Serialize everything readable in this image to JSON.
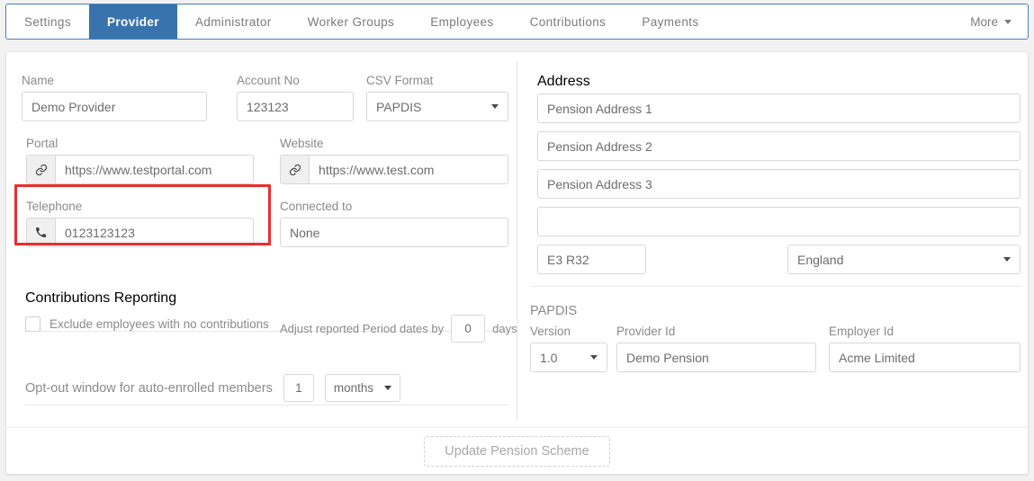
{
  "tabs": [
    {
      "label": "Settings",
      "active": false
    },
    {
      "label": "Provider",
      "active": true
    },
    {
      "label": "Administrator",
      "active": false
    },
    {
      "label": "Worker Groups",
      "active": false
    },
    {
      "label": "Employees",
      "active": false
    },
    {
      "label": "Contributions",
      "active": false
    },
    {
      "label": "Payments",
      "active": false
    }
  ],
  "tabbar": {
    "more_label": "More",
    "active_color": "#3973ad",
    "border_color": "#4a7ebb"
  },
  "form": {
    "name": {
      "label": "Name",
      "value": "Demo Provider"
    },
    "account_no": {
      "label": "Account No",
      "value": "123123"
    },
    "csv_format": {
      "label": "CSV Format",
      "value": "PAPDIS"
    },
    "portal": {
      "label": "Portal",
      "value": "https://www.testportal.com",
      "icon": "link-icon"
    },
    "website": {
      "label": "Website",
      "value": "https://www.test.com",
      "icon": "link-icon"
    },
    "telephone": {
      "label": "Telephone",
      "value": "0123123123",
      "icon": "phone-icon"
    },
    "connected_to": {
      "label": "Connected to",
      "value": "None"
    }
  },
  "contributions_reporting": {
    "title": "Contributions Reporting",
    "exclude_label": "Exclude employees with no contributions",
    "exclude_checked": false,
    "adjust_prefix": "Adjust reported Period dates by",
    "adjust_value": "0",
    "adjust_suffix": "days"
  },
  "optout": {
    "label": "Opt-out window for auto-enrolled members",
    "value": "1",
    "unit": "months"
  },
  "address": {
    "label": "Address",
    "line1": "Pension Address 1",
    "line2": "Pension Address 2",
    "line3": "Pension Address 3",
    "line4": "",
    "postcode": "E3 R32",
    "country": "England"
  },
  "papdis": {
    "title": "PAPDIS",
    "version": {
      "label": "Version",
      "value": "1.0"
    },
    "provider_id": {
      "label": "Provider Id",
      "value": "Demo Pension"
    },
    "employer_id": {
      "label": "Employer Id",
      "value": "Acme Limited"
    }
  },
  "footer": {
    "update_button": "Update Pension Scheme"
  },
  "annotation": {
    "highlight_color": "#ee2c2c",
    "highlights": [
      "portal-field"
    ]
  }
}
